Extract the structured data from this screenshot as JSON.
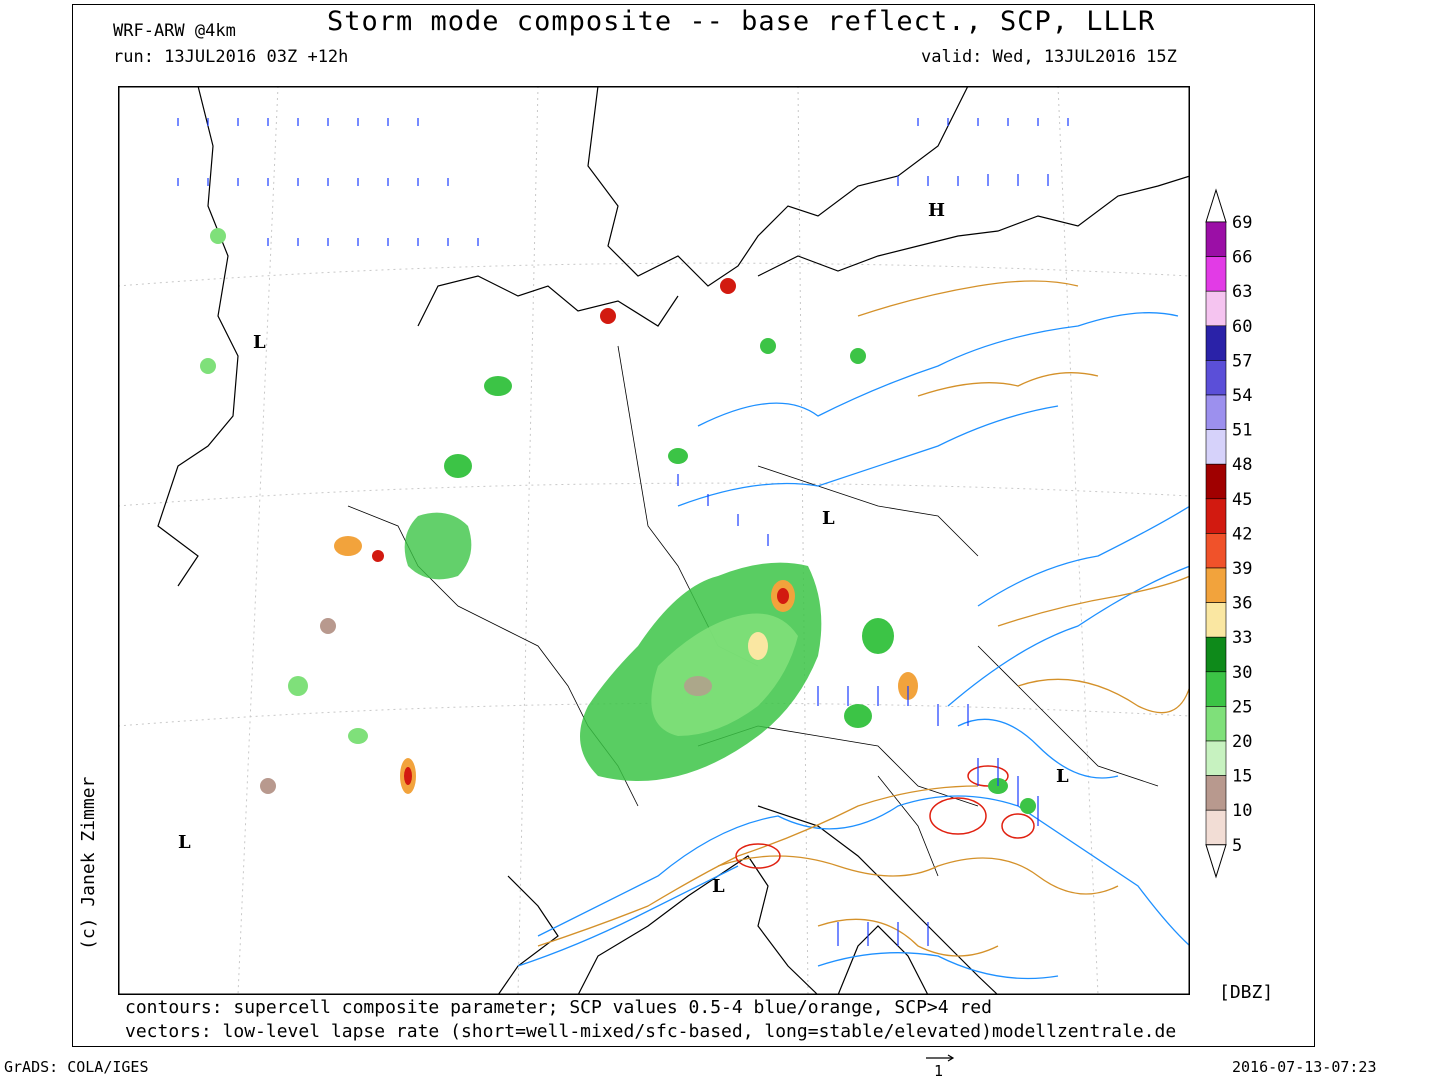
{
  "header": {
    "title": "Storm mode composite -- base reflect., SCP, LLLR",
    "model": "WRF-ARW @4km",
    "run": "run: 13JUL2016 03Z +12h",
    "valid": "valid: Wed, 13JUL2016 15Z"
  },
  "footer": {
    "contours_note": "contours: supercell composite parameter; SCP values 0.5-4 blue/orange, SCP>4 red",
    "vectors_note": "vectors: low-level lapse rate (short=well-mixed/sfc-based, long=stable/elevated)modellzentrale.de",
    "software": "GrADS: COLA/IGES",
    "timestamp": "2016-07-13-07:23",
    "vector_reference": "1"
  },
  "credit": "(c) Janek Zimmer",
  "colorbar": {
    "units": "[DBZ]",
    "levels": [
      "69",
      "66",
      "63",
      "60",
      "57",
      "54",
      "51",
      "48",
      "45",
      "42",
      "39",
      "36",
      "33",
      "30",
      "25",
      "20",
      "15",
      "10",
      "5"
    ],
    "colors": [
      "#9b0fa6",
      "#e23be6",
      "#f5c4f0",
      "#2a22a8",
      "#5b4fd8",
      "#9c90ee",
      "#d6d2fa",
      "#a00000",
      "#d21a10",
      "#f0522a",
      "#f2a33c",
      "#fae7a2",
      "#0e8a1a",
      "#3cc446",
      "#7fe07a",
      "#c7f2c0",
      "#b8998e",
      "#f2ddd5"
    ]
  },
  "pressure_centers": [
    {
      "label": "H"
    },
    {
      "label": "L"
    },
    {
      "label": "L"
    },
    {
      "label": "L"
    },
    {
      "label": "L"
    },
    {
      "label": "L"
    }
  ],
  "colors": {
    "scp_low": "#1e90ff",
    "scp_mid": "#d4912a",
    "scp_high": "#e02010",
    "vectors": "#1a3cff",
    "coastline": "#000000",
    "grid": "#c8c8c8"
  }
}
